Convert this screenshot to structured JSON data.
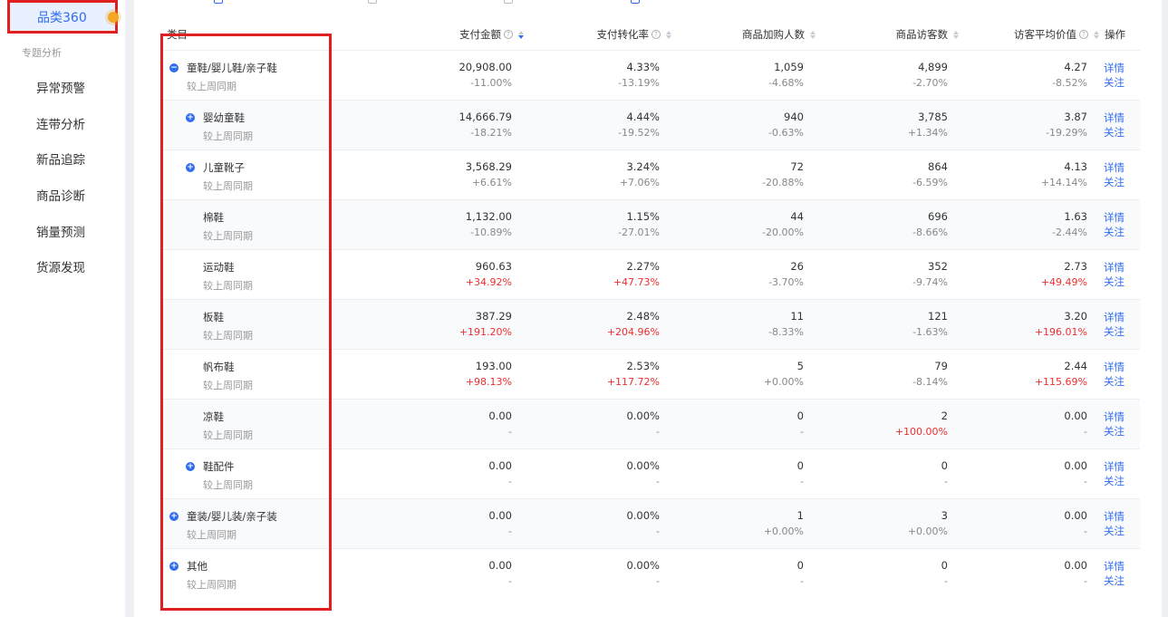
{
  "sidebar": {
    "active": "品类360",
    "section": "专题分析",
    "items": [
      "异常预警",
      "连带分析",
      "新品追踪",
      "商品诊断",
      "销量预测",
      "货源发现"
    ]
  },
  "table": {
    "headers": {
      "category": "类目",
      "pay_amount": "支付金额",
      "conversion": "支付转化率",
      "cart_users": "商品加购人数",
      "visitors": "商品访客数",
      "visitor_value": "访客平均价值",
      "ops": "操作"
    },
    "compare_label": "较上周同期",
    "op_detail": "详情",
    "op_follow": "关注",
    "rows": [
      {
        "name": "童鞋/婴儿鞋/亲子鞋",
        "level": 0,
        "icon": "minus",
        "pay": "20,908.00",
        "pay_c": "-11.00%",
        "conv": "4.33%",
        "conv_c": "-13.19%",
        "cart": "1,059",
        "cart_c": "-4.68%",
        "vis": "4,899",
        "vis_c": "-2.70%",
        "val": "4.27",
        "val_c": "-8.52%"
      },
      {
        "name": "婴幼童鞋",
        "level": 1,
        "icon": "plus",
        "pay": "14,666.79",
        "pay_c": "-18.21%",
        "conv": "4.44%",
        "conv_c": "-19.52%",
        "cart": "940",
        "cart_c": "-0.63%",
        "vis": "3,785",
        "vis_c": "+1.34%",
        "val": "3.87",
        "val_c": "-19.29%"
      },
      {
        "name": "儿童靴子",
        "level": 1,
        "icon": "plus",
        "pay": "3,568.29",
        "pay_c": "+6.61%",
        "conv": "3.24%",
        "conv_c": "+7.06%",
        "cart": "72",
        "cart_c": "-20.88%",
        "vis": "864",
        "vis_c": "-6.59%",
        "val": "4.13",
        "val_c": "+14.14%"
      },
      {
        "name": "棉鞋",
        "level": 1,
        "icon": "",
        "pay": "1,132.00",
        "pay_c": "-10.89%",
        "conv": "1.15%",
        "conv_c": "-27.01%",
        "cart": "44",
        "cart_c": "-20.00%",
        "vis": "696",
        "vis_c": "-8.66%",
        "val": "1.63",
        "val_c": "-2.44%"
      },
      {
        "name": "运动鞋",
        "level": 1,
        "icon": "",
        "pay": "960.63",
        "pay_c": "+34.92%",
        "conv": "2.27%",
        "conv_c": "+47.73%",
        "cart": "26",
        "cart_c": "-3.70%",
        "vis": "352",
        "vis_c": "-9.74%",
        "val": "2.73",
        "val_c": "+49.49%",
        "red": [
          "pay_c",
          "conv_c",
          "val_c"
        ]
      },
      {
        "name": "板鞋",
        "level": 1,
        "icon": "",
        "pay": "387.29",
        "pay_c": "+191.20%",
        "conv": "2.48%",
        "conv_c": "+204.96%",
        "cart": "11",
        "cart_c": "-8.33%",
        "vis": "121",
        "vis_c": "-1.63%",
        "val": "3.20",
        "val_c": "+196.01%",
        "red": [
          "pay_c",
          "conv_c",
          "val_c"
        ]
      },
      {
        "name": "帆布鞋",
        "level": 1,
        "icon": "",
        "pay": "193.00",
        "pay_c": "+98.13%",
        "conv": "2.53%",
        "conv_c": "+117.72%",
        "cart": "5",
        "cart_c": "+0.00%",
        "vis": "79",
        "vis_c": "-8.14%",
        "val": "2.44",
        "val_c": "+115.69%",
        "red": [
          "pay_c",
          "conv_c",
          "val_c"
        ]
      },
      {
        "name": "凉鞋",
        "level": 1,
        "icon": "",
        "pay": "0.00",
        "pay_c": "-",
        "conv": "0.00%",
        "conv_c": "-",
        "cart": "0",
        "cart_c": "-",
        "vis": "2",
        "vis_c": "+100.00%",
        "val": "0.00",
        "val_c": "-",
        "red": [
          "vis_c"
        ]
      },
      {
        "name": "鞋配件",
        "level": 1,
        "icon": "plus",
        "pay": "0.00",
        "pay_c": "-",
        "conv": "0.00%",
        "conv_c": "-",
        "cart": "0",
        "cart_c": "-",
        "vis": "0",
        "vis_c": "-",
        "val": "0.00",
        "val_c": "-"
      },
      {
        "name": "童装/婴儿装/亲子装",
        "level": 0,
        "icon": "plus",
        "pay": "0.00",
        "pay_c": "-",
        "conv": "0.00%",
        "conv_c": "-",
        "cart": "1",
        "cart_c": "+0.00%",
        "vis": "3",
        "vis_c": "+0.00%",
        "val": "0.00",
        "val_c": "-"
      },
      {
        "name": "其他",
        "level": 0,
        "icon": "plus",
        "pay": "0.00",
        "pay_c": "-",
        "conv": "0.00%",
        "conv_c": "-",
        "cart": "0",
        "cart_c": "-",
        "vis": "0",
        "vis_c": "-",
        "val": "0.00",
        "val_c": "-"
      }
    ]
  }
}
